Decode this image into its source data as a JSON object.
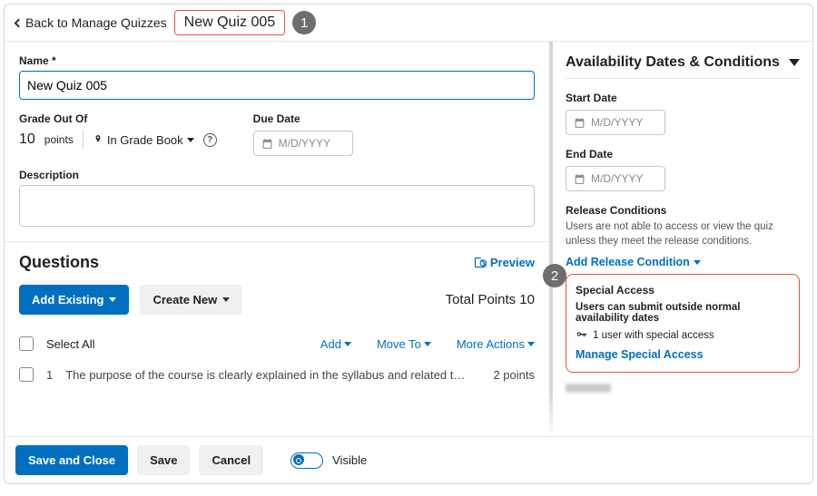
{
  "header": {
    "back_label": "Back to Manage Quizzes",
    "quiz_title": "New Quiz 005",
    "step1": "1"
  },
  "main": {
    "name_label": "Name *",
    "name_value": "New Quiz 005",
    "grade_label": "Grade Out Of",
    "grade_value": "10",
    "grade_unit": "points",
    "gradebook_label": "In Grade Book",
    "due_label": "Due Date",
    "due_placeholder": "M/D/YYYY",
    "desc_label": "Description",
    "questions_title": "Questions",
    "preview_label": "Preview",
    "add_existing": "Add Existing",
    "create_new": "Create New",
    "total_points": "Total Points 10",
    "select_all": "Select All",
    "add_menu": "Add",
    "move_menu": "Move To",
    "more_menu": "More Actions",
    "q1_num": "1",
    "q1_text": "The purpose of the course is clearly explained in the syllabus and related t…",
    "q1_pts": "2 points"
  },
  "footer": {
    "save_close": "Save and Close",
    "save": "Save",
    "cancel": "Cancel",
    "visible": "Visible"
  },
  "side": {
    "title": "Availability Dates & Conditions",
    "start_label": "Start Date",
    "start_placeholder": "M/D/YYYY",
    "end_label": "End Date",
    "end_placeholder": "M/D/YYYY",
    "rc_title": "Release Conditions",
    "rc_desc": "Users are not able to access or view the quiz unless they meet the release conditions.",
    "add_rc": "Add Release Condition",
    "step2": "2",
    "sa_title": "Special Access",
    "sa_line": "Users can submit outside normal availability dates",
    "sa_count": "1 user with special access",
    "sa_manage": "Manage Special Access"
  }
}
